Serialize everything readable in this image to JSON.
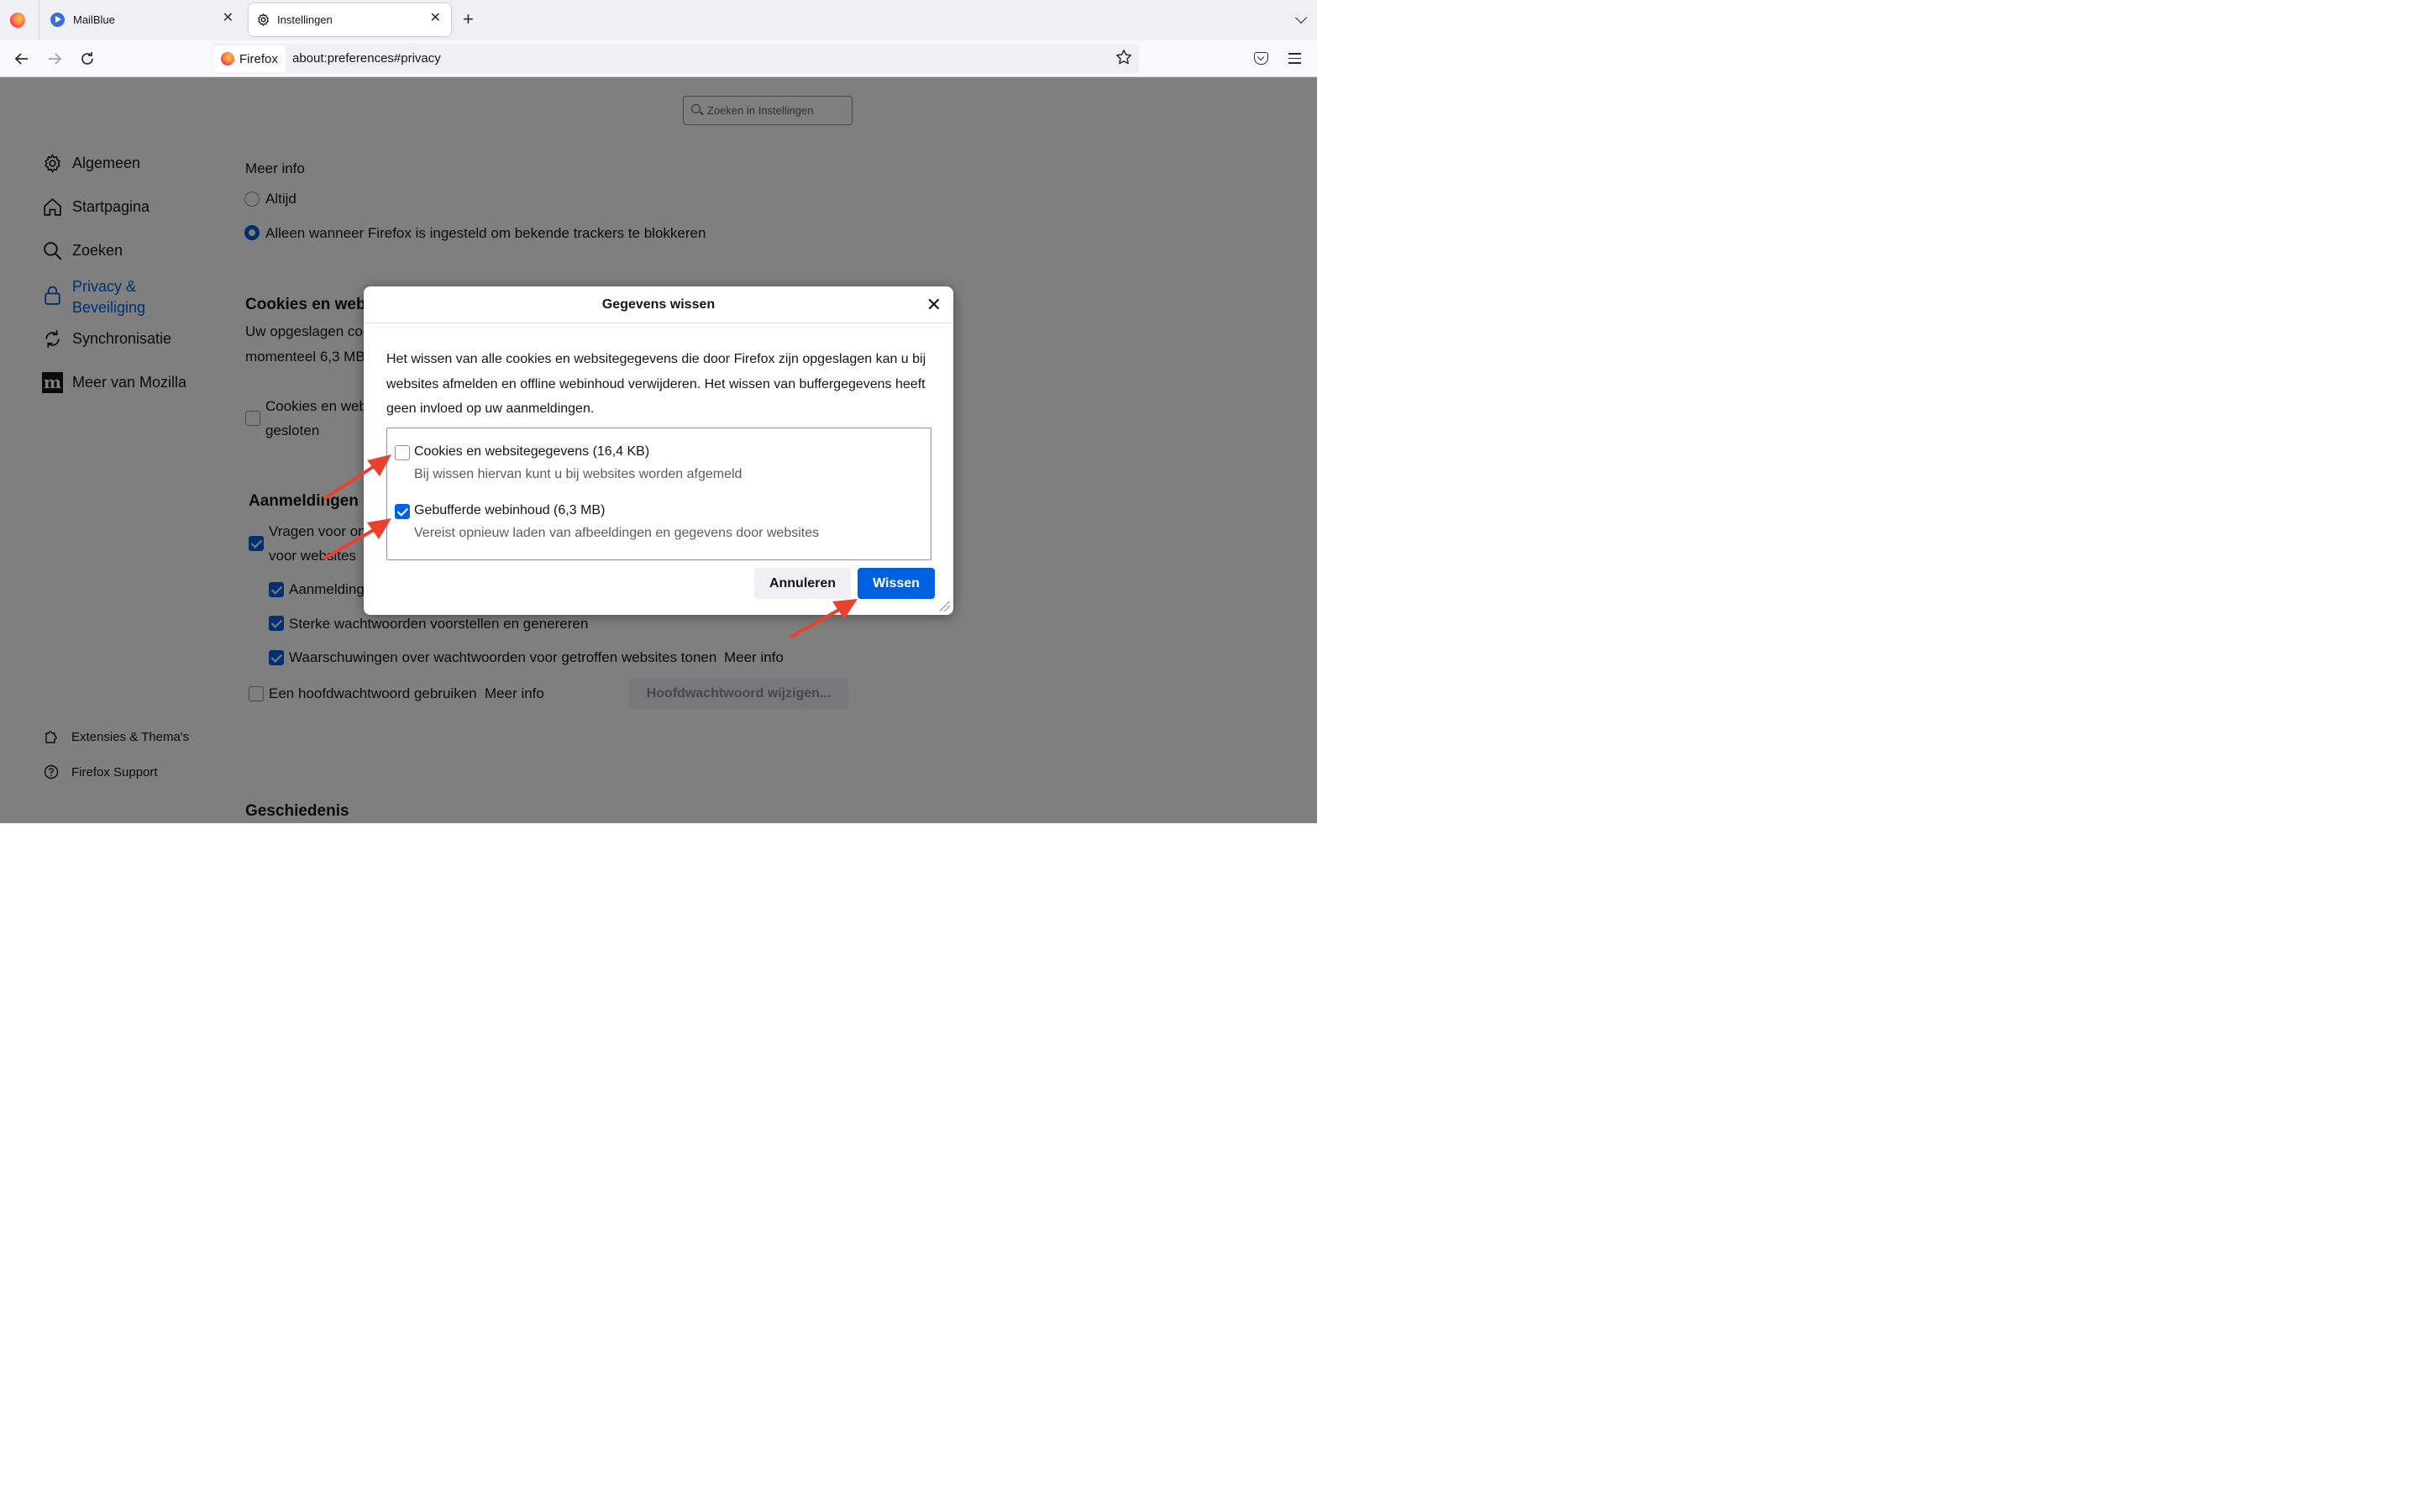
{
  "browser": {
    "tabs": [
      {
        "label": "MailBlue",
        "close": "✕"
      },
      {
        "label": "Instellingen",
        "close": "✕"
      }
    ],
    "new_tab": "+",
    "identity_label": "Firefox",
    "url": "about:preferences#privacy"
  },
  "search": {
    "placeholder": "Zoeken in Instellingen"
  },
  "sidebar": {
    "items": [
      {
        "label": "Algemeen",
        "icon": "gear-icon"
      },
      {
        "label": "Startpagina",
        "icon": "home-icon"
      },
      {
        "label": "Zoeken",
        "icon": "search-icon"
      },
      {
        "label": "Privacy &",
        "label2": "Beveiliging",
        "icon": "lock-icon"
      },
      {
        "label": "Synchronisatie",
        "icon": "sync-icon"
      },
      {
        "label": "Meer van Mozilla",
        "icon": "mozilla-icon"
      }
    ],
    "footer": [
      {
        "label": "Extensies & Thema's",
        "icon": "puzzle-icon"
      },
      {
        "label": "Firefox Support",
        "icon": "help-icon"
      }
    ]
  },
  "page": {
    "meer_info": "Meer info",
    "radio_always": "Altijd",
    "radio_only_when": "Alleen wanneer Firefox is ingesteld om bekende trackers te blokkeren",
    "cookies_heading": "Cookies en webs",
    "cookies_desc_1": "Uw opgeslagen coo",
    "cookies_desc_2": "momenteel 6,3 MB",
    "cookies_cb_line1": "Cookies en web",
    "cookies_cb_line2": "gesloten",
    "logins_heading": "Aanmeldingen e",
    "ask_save_line1": "Vragen voor on",
    "ask_save_line2": "voor websites",
    "autofill": "Aanmelding",
    "suggest_passwords": "Sterke wachtwoorden voorstellen en genereren",
    "breach_alerts": "Waarschuwingen over wachtwoorden voor getroffen websites tonen",
    "breach_link": "Meer info",
    "primary_password": "Een hoofdwachtwoord gebruiken",
    "primary_link": "Meer info",
    "change_primary_button": "Hoofdwachtwoord wijzigen...",
    "history_heading": "Geschiedenis"
  },
  "dialog": {
    "title": "Gegevens wissen",
    "close": "✕",
    "description": "Het wissen van alle cookies en websitegegevens die door Firefox zijn opgeslagen kan u bij websites afmelden en offline webinhoud verwijderen. Het wissen van buffergegevens heeft geen invloed op uw aanmeldingen.",
    "options": [
      {
        "label": "Cookies en websitegegevens (16,4 KB)",
        "sub": "Bij wissen hiervan kunt u bij websites worden afgemeld",
        "checked": false
      },
      {
        "label": "Gebufferde webinhoud (6,3 MB)",
        "sub": "Vereist opnieuw laden van afbeeldingen en gegevens door websites",
        "checked": true
      }
    ],
    "cancel_button": "Annuleren",
    "clear_button": "Wissen"
  },
  "colors": {
    "accent": "#0061e0",
    "annotation_arrow": "#e8422f"
  }
}
